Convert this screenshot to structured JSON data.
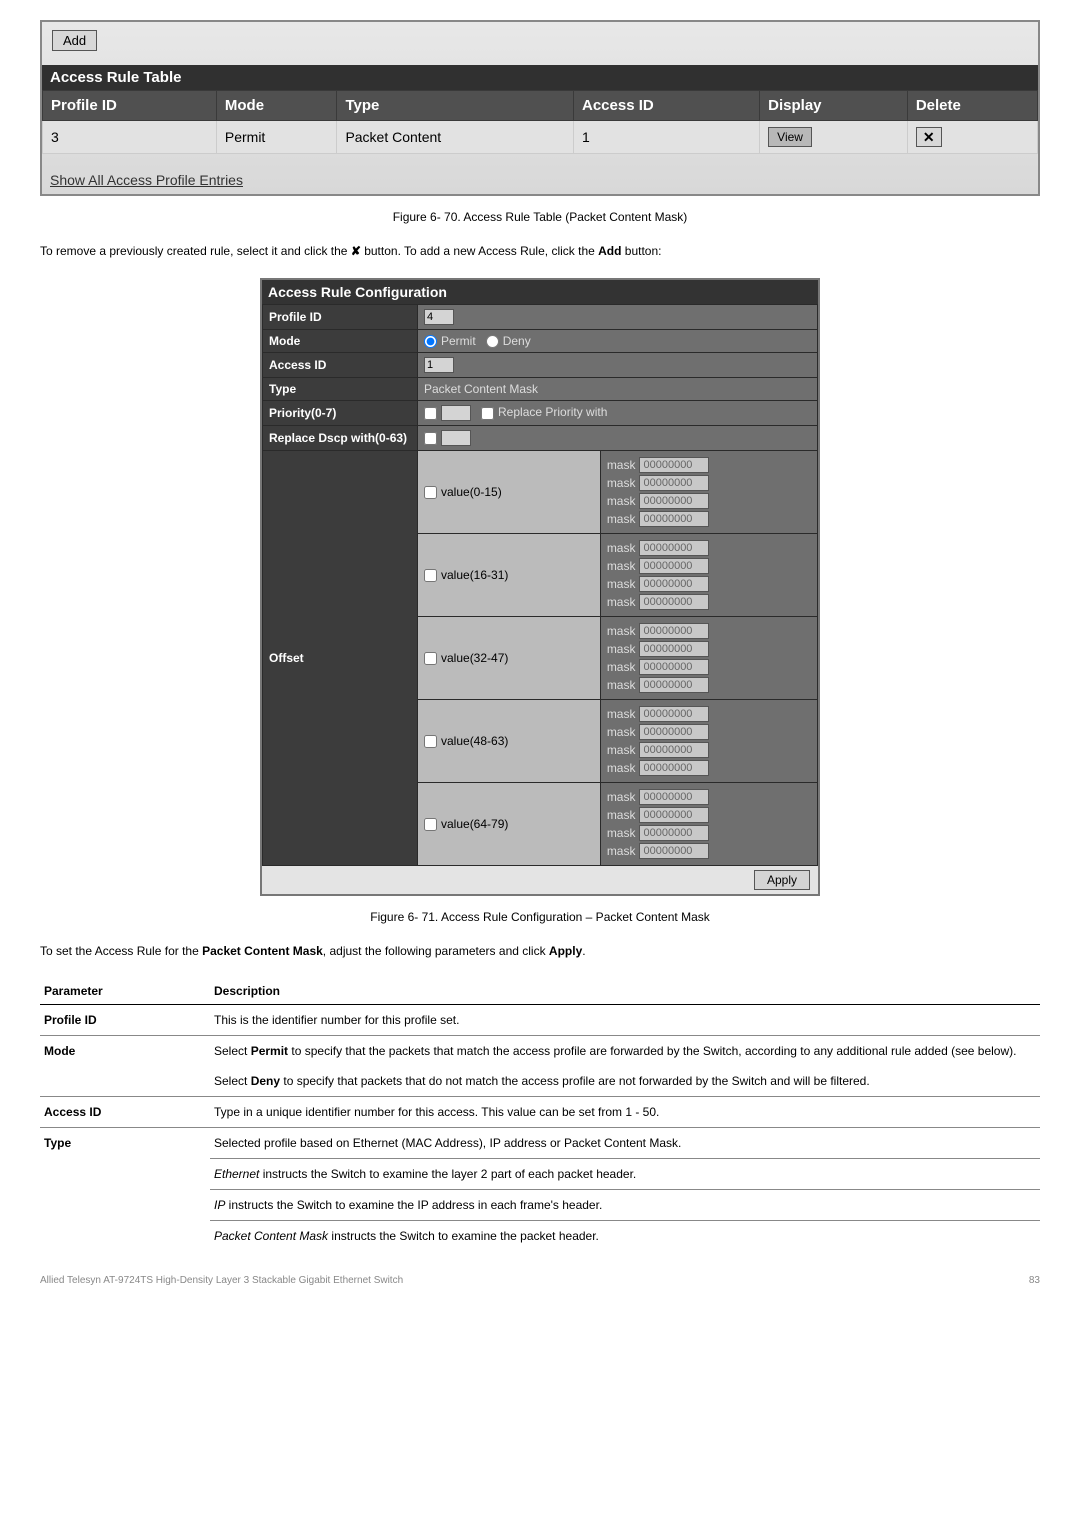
{
  "table1": {
    "addLabel": "Add",
    "title": "Access Rule Table",
    "headers": [
      "Profile ID",
      "Mode",
      "Type",
      "Access ID",
      "Display",
      "Delete"
    ],
    "row": {
      "profileId": "3",
      "mode": "Permit",
      "type": "Packet Content",
      "accessId": "1",
      "viewLabel": "View",
      "deleteLabel": "✕"
    },
    "footerLink": "Show All Access Profile Entries"
  },
  "caption1": "Figure 6- 70. Access Rule Table (Packet Content Mask)",
  "instr1_prefix": "To remove a previously created rule, select it and click the ",
  "instr1_mid": " button. To add a new Access Rule, click the ",
  "instr1_suffix": " button:",
  "xSymbol": "✘",
  "addBold": "Add",
  "config": {
    "title": "Access Rule Configuration",
    "rows": {
      "profileIdLabel": "Profile ID",
      "profileIdVal": "4",
      "modeLabel": "Mode",
      "permitLabel": "Permit",
      "denyLabel": "Deny",
      "accessIdLabel": "Access ID",
      "accessIdVal": "1",
      "typeLabel": "Type",
      "typeVal": "Packet Content Mask",
      "priorityLabel": "Priority(0-7)",
      "replacePriorityLabel": "Replace Priority with",
      "replaceDscpLabel": "Replace Dscp with(0-63)",
      "offsetLabel": "Offset",
      "maskWord": "mask",
      "maskVal": "00000000",
      "ranges": [
        "value(0-15)",
        "value(16-31)",
        "value(32-47)",
        "value(48-63)",
        "value(64-79)"
      ],
      "applyLabel": "Apply"
    }
  },
  "caption2": "Figure 6- 71. Access Rule Configuration – Packet Content Mask",
  "instr2_prefix": "To set the Access Rule for the ",
  "instr2_bold": "Packet Content Mask",
  "instr2_mid": ", adjust the following parameters and click ",
  "instr2_bold2": "Apply",
  "instr2_end": ".",
  "params": {
    "head1": "Parameter",
    "head2": "Description",
    "rows": [
      {
        "name": "Profile ID",
        "desc": "This is the identifier number for this profile set."
      },
      {
        "name": "Mode",
        "desc_prefix": "Select ",
        "desc_bold": "Permit",
        "desc_suffix": " to specify that the packets that match the access profile are forwarded by the Switch, according to any additional rule added (see below)."
      },
      {
        "name": "",
        "desc_prefix": "Select ",
        "desc_bold": "Deny",
        "desc_suffix": " to specify that packets that do not match the access profile are not forwarded by the Switch and will be filtered."
      },
      {
        "name": "Access ID",
        "desc": "Type in a unique identifier number for this access. This value can be set from 1 - 50."
      },
      {
        "name": "Type",
        "desc": "Selected profile based on Ethernet (MAC Address), IP address or Packet Content Mask."
      },
      {
        "name": "",
        "desc_italic": "Ethernet",
        "desc_suffix": " instructs the Switch to examine the layer 2 part of each packet header."
      },
      {
        "name": "",
        "desc_italic": "IP",
        "desc_suffix": " instructs the Switch to examine the IP address in each frame's header."
      },
      {
        "name": "",
        "desc_italic": "Packet Content Mask",
        "desc_suffix": " instructs the Switch to examine the packet header."
      }
    ]
  },
  "footer": {
    "left": "Allied Telesyn AT-9724TS High-Density Layer 3 Stackable Gigabit Ethernet Switch",
    "right": "83"
  }
}
